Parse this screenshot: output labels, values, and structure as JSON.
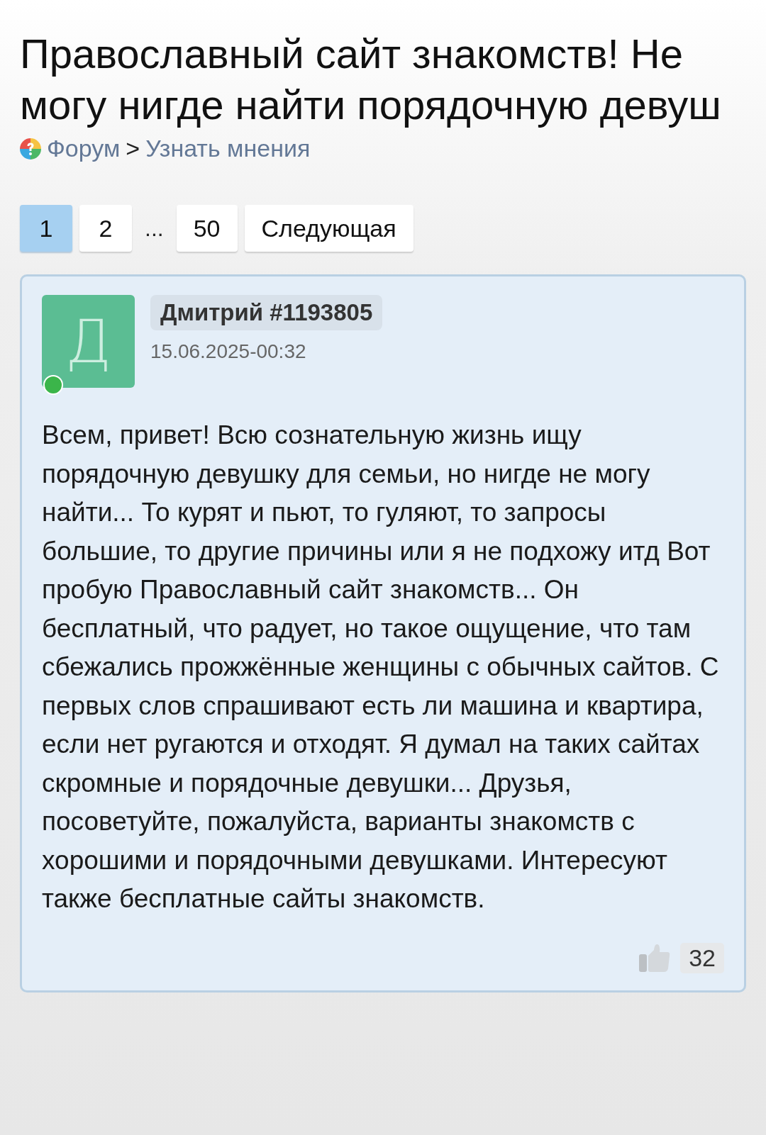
{
  "title": "Православный сайт знакомств! Не могу нигде найти порядочную девуш",
  "breadcrumb": {
    "items": [
      "Форум",
      "Узнать мнения"
    ],
    "separator": ">"
  },
  "pagination": [
    {
      "label": "1",
      "kind": "page",
      "selected": true
    },
    {
      "label": "2",
      "kind": "page",
      "selected": false
    },
    {
      "label": "...",
      "kind": "gap"
    },
    {
      "label": "50",
      "kind": "page",
      "selected": false
    },
    {
      "label": "Следующая",
      "kind": "page",
      "selected": false
    }
  ],
  "post": {
    "avatar_letter": "Д",
    "online": true,
    "author": "Дмитрий #1193805",
    "date": "15.06.2025-00:32",
    "body": "Всем, привет! Всю сознательную жизнь ищу порядочную девушку для семьи, но нигде не могу найти... То курят и пьют, то гуляют, то запросы большие, то другие причины или я не подхожу итд Вот пробую Православный сайт знакомств... Он бесплатный, что радует, но такое ощущение, что там сбежались прожжённые женщины с обычных сайтов. С первых слов спрашивают есть ли машина и квартира, если нет ругаются и отходят. Я думал на таких сайтах скромные и порядочные девушки... Друзья, посоветуйте, пожалуйста, варианты знакомств с хорошими и порядочными девушками. Интересуют также бесплатные сайты знакомств.",
    "likes": "32"
  }
}
